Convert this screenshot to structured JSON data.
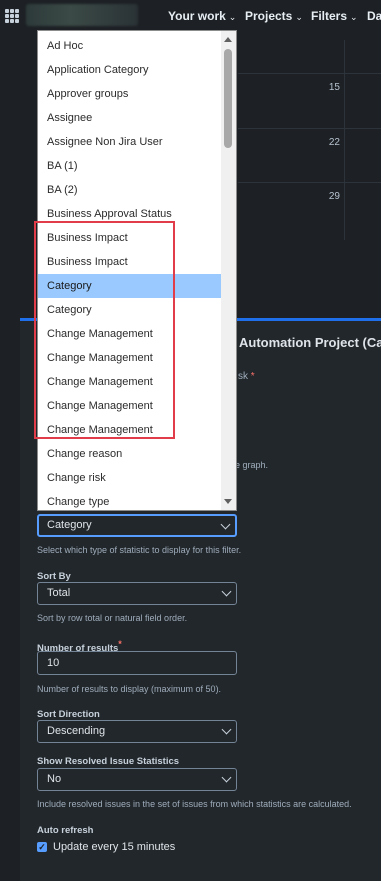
{
  "topbar": {
    "apps_icon": "grid-icon",
    "nav": [
      {
        "label": "Your work"
      },
      {
        "label": "Projects"
      },
      {
        "label": "Filters"
      },
      {
        "label": "Da"
      }
    ]
  },
  "calendar": {
    "days": [
      "15",
      "22",
      "29"
    ]
  },
  "gadget": {
    "title": "Automation Project (Cate",
    "fragment_field": "sk",
    "fragment_help": "e graph.",
    "statistic_type": {
      "value": "Category",
      "help": "Select which type of statistic to display for this filter."
    },
    "sort_by": {
      "label": "Sort By",
      "value": "Total",
      "help": "Sort by row total or natural field order."
    },
    "number_of_results": {
      "label": "Number of results",
      "value": "10",
      "help": "Number of results to display (maximum of 50)."
    },
    "sort_direction": {
      "label": "Sort Direction",
      "value": "Descending"
    },
    "show_resolved": {
      "label": "Show Resolved Issue Statistics",
      "value": "No",
      "help": "Include resolved issues in the set of issues from which statistics are calculated."
    },
    "auto_refresh": {
      "label": "Auto refresh",
      "checkbox_label": "Update every 15 minutes",
      "checked": true
    }
  },
  "dropdown": {
    "selected": "Category",
    "options": [
      "Ad Hoc",
      "Application Category",
      "Approver groups",
      "Assignee",
      "Assignee Non Jira User",
      "BA (1)",
      "BA (2)",
      "Business Approval Status",
      "Business Impact",
      "Business Impact",
      "Category",
      "Category",
      "Change Management",
      "Change Management",
      "Change Management",
      "Change Management",
      "Change Management",
      "Change reason",
      "Change risk",
      "Change type"
    ]
  },
  "colors": {
    "accent": "#579dff",
    "highlight": "#e03c4a",
    "selected_option": "#99c9ff"
  }
}
